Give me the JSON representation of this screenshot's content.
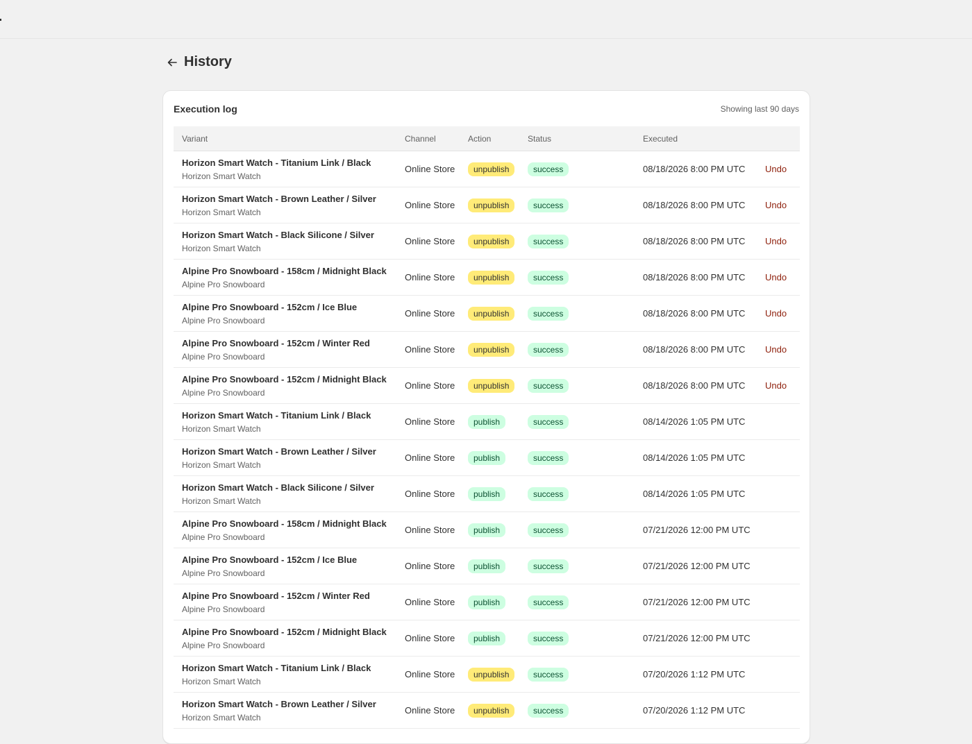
{
  "page": {
    "title": "History",
    "back_icon": "arrow-left-icon"
  },
  "card": {
    "title": "Execution log",
    "subtitle": "Showing last 90 days"
  },
  "table": {
    "headers": {
      "variant": "Variant",
      "channel": "Channel",
      "action": "Action",
      "status": "Status",
      "executed": "Executed"
    },
    "rows": [
      {
        "variant": "Horizon Smart Watch - Titanium Link / Black",
        "product": "Horizon Smart Watch",
        "channel": "Online Store",
        "action": "unpublish",
        "status": "success",
        "executed": "08/18/2026 8:00 PM UTC",
        "undo": "Undo"
      },
      {
        "variant": "Horizon Smart Watch - Brown Leather / Silver",
        "product": "Horizon Smart Watch",
        "channel": "Online Store",
        "action": "unpublish",
        "status": "success",
        "executed": "08/18/2026 8:00 PM UTC",
        "undo": "Undo"
      },
      {
        "variant": "Horizon Smart Watch - Black Silicone / Silver",
        "product": "Horizon Smart Watch",
        "channel": "Online Store",
        "action": "unpublish",
        "status": "success",
        "executed": "08/18/2026 8:00 PM UTC",
        "undo": "Undo"
      },
      {
        "variant": "Alpine Pro Snowboard - 158cm / Midnight Black",
        "product": "Alpine Pro Snowboard",
        "channel": "Online Store",
        "action": "unpublish",
        "status": "success",
        "executed": "08/18/2026 8:00 PM UTC",
        "undo": "Undo"
      },
      {
        "variant": "Alpine Pro Snowboard - 152cm / Ice Blue",
        "product": "Alpine Pro Snowboard",
        "channel": "Online Store",
        "action": "unpublish",
        "status": "success",
        "executed": "08/18/2026 8:00 PM UTC",
        "undo": "Undo"
      },
      {
        "variant": "Alpine Pro Snowboard - 152cm / Winter Red",
        "product": "Alpine Pro Snowboard",
        "channel": "Online Store",
        "action": "unpublish",
        "status": "success",
        "executed": "08/18/2026 8:00 PM UTC",
        "undo": "Undo"
      },
      {
        "variant": "Alpine Pro Snowboard - 152cm / Midnight Black",
        "product": "Alpine Pro Snowboard",
        "channel": "Online Store",
        "action": "unpublish",
        "status": "success",
        "executed": "08/18/2026 8:00 PM UTC",
        "undo": "Undo"
      },
      {
        "variant": "Horizon Smart Watch - Titanium Link / Black",
        "product": "Horizon Smart Watch",
        "channel": "Online Store",
        "action": "publish",
        "status": "success",
        "executed": "08/14/2026 1:05 PM UTC",
        "undo": ""
      },
      {
        "variant": "Horizon Smart Watch - Brown Leather / Silver",
        "product": "Horizon Smart Watch",
        "channel": "Online Store",
        "action": "publish",
        "status": "success",
        "executed": "08/14/2026 1:05 PM UTC",
        "undo": ""
      },
      {
        "variant": "Horizon Smart Watch - Black Silicone / Silver",
        "product": "Horizon Smart Watch",
        "channel": "Online Store",
        "action": "publish",
        "status": "success",
        "executed": "08/14/2026 1:05 PM UTC",
        "undo": ""
      },
      {
        "variant": "Alpine Pro Snowboard - 158cm / Midnight Black",
        "product": "Alpine Pro Snowboard",
        "channel": "Online Store",
        "action": "publish",
        "status": "success",
        "executed": "07/21/2026 12:00 PM UTC",
        "undo": ""
      },
      {
        "variant": "Alpine Pro Snowboard - 152cm / Ice Blue",
        "product": "Alpine Pro Snowboard",
        "channel": "Online Store",
        "action": "publish",
        "status": "success",
        "executed": "07/21/2026 12:00 PM UTC",
        "undo": ""
      },
      {
        "variant": "Alpine Pro Snowboard - 152cm / Winter Red",
        "product": "Alpine Pro Snowboard",
        "channel": "Online Store",
        "action": "publish",
        "status": "success",
        "executed": "07/21/2026 12:00 PM UTC",
        "undo": ""
      },
      {
        "variant": "Alpine Pro Snowboard - 152cm / Midnight Black",
        "product": "Alpine Pro Snowboard",
        "channel": "Online Store",
        "action": "publish",
        "status": "success",
        "executed": "07/21/2026 12:00 PM UTC",
        "undo": ""
      },
      {
        "variant": "Horizon Smart Watch - Titanium Link / Black",
        "product": "Horizon Smart Watch",
        "channel": "Online Store",
        "action": "unpublish",
        "status": "success",
        "executed": "07/20/2026 1:12 PM UTC",
        "undo": ""
      },
      {
        "variant": "Horizon Smart Watch - Brown Leather / Silver",
        "product": "Horizon Smart Watch",
        "channel": "Online Store",
        "action": "unpublish",
        "status": "success",
        "executed": "07/20/2026 1:12 PM UTC",
        "undo": ""
      }
    ]
  },
  "colors": {
    "page_bg": "#f1f1f1",
    "unpublish_badge": "#ffeb78",
    "success_badge": "#cdfee1",
    "undo_link": "#8e1f0b"
  }
}
